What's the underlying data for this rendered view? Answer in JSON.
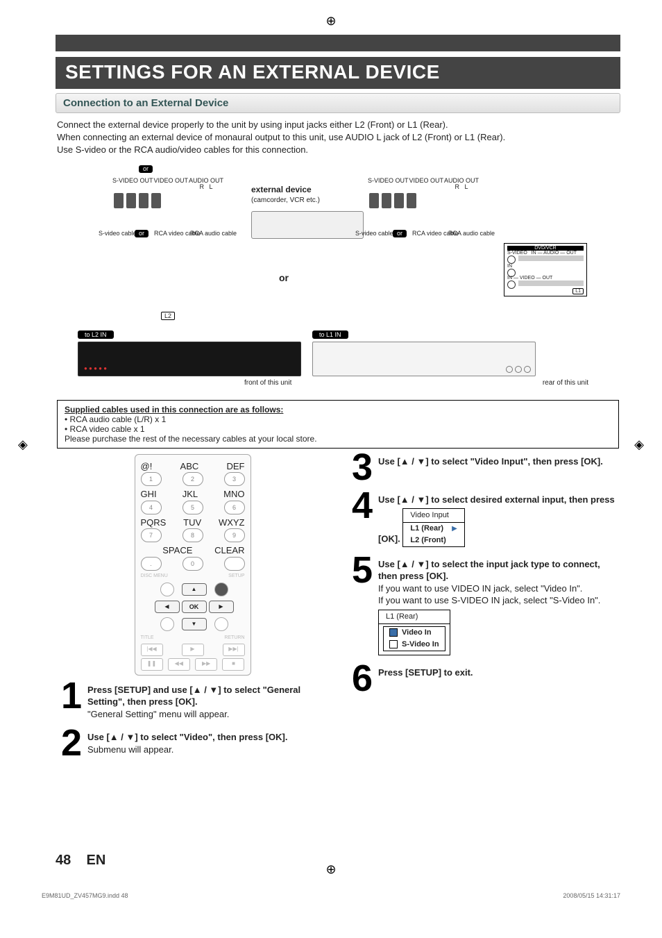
{
  "colors": {
    "band": "#444",
    "accent": "#3a6ea8"
  },
  "title": "SETTINGS FOR AN EXTERNAL DEVICE",
  "subheading": "Connection to an External Device",
  "intro": [
    "Connect the external device properly to the unit by using input jacks either L2 (Front) or L1 (Rear).",
    "When connecting an external device of monaural output to this unit, use AUDIO L jack of L2 (Front) or L1 (Rear).",
    "Use S-video or the RCA audio/video cables for this connection."
  ],
  "diagram": {
    "or": "or",
    "ports_left": [
      "S-VIDEO OUT",
      "VIDEO OUT",
      "AUDIO OUT",
      "R",
      "L"
    ],
    "ports_right": [
      "S-VIDEO OUT",
      "VIDEO OUT",
      "AUDIO OUT",
      "R",
      "L"
    ],
    "cable_labels": [
      "S-video cable",
      "RCA video cable",
      "RCA audio cable"
    ],
    "external_device_title": "external device",
    "external_device_sub": "(camcorder, VCR etc.)",
    "big_or": "or",
    "to_l2": "to L2 IN",
    "to_l1": "to L1 IN",
    "L2": "L2",
    "L1": "L1",
    "dvd_vcr": "DVD/VCR",
    "svideo": "S-VIDEO",
    "in_video_out": "IN — VIDEO — OUT",
    "in_audio_out": "IN — AUDIO — OUT",
    "in": "IN",
    "front_caption": "front of this unit",
    "rear_caption": "rear of this unit"
  },
  "cables_note": {
    "heading": "Supplied cables used in this connection are as follows:",
    "items": [
      "• RCA audio cable (L/R) x 1",
      "• RCA video cable x 1"
    ],
    "footer": "Please purchase the rest of the necessary cables at your local store."
  },
  "remote": {
    "numTop": [
      [
        "@!",
        "ABC",
        "DEF"
      ],
      [
        "1",
        "2",
        "3"
      ],
      [
        "GHI",
        "JKL",
        "MNO"
      ],
      [
        "4",
        "5",
        "6"
      ],
      [
        "PQRS",
        "TUV",
        "WXYZ"
      ],
      [
        "7",
        "8",
        "9"
      ],
      [
        "",
        "SPACE",
        "CLEAR"
      ],
      [
        ".",
        "0",
        ""
      ]
    ],
    "disc_menu": "DISC MENU",
    "setup": "SETUP",
    "ok": "OK",
    "title": "TITLE",
    "return": "RETURN"
  },
  "steps": {
    "1": {
      "num": "1",
      "main": "Press [SETUP] and use [▲ / ▼] to select \"General Setting\", then press [OK].",
      "sub": "\"General Setting\" menu will appear."
    },
    "2": {
      "num": "2",
      "main": "Use [▲ / ▼] to select \"Video\", then press [OK].",
      "sub": "Submenu will appear."
    },
    "3": {
      "num": "3",
      "main": "Use [▲ / ▼] to select \"Video Input\", then press [OK]."
    },
    "4": {
      "num": "4",
      "main": "Use [▲ / ▼] to select desired external input, then press [OK]."
    },
    "5": {
      "num": "5",
      "main": "Use [▲ / ▼] to select the input jack type to connect, then press [OK].",
      "sub1": "If you want to use VIDEO IN jack, select \"Video In\".",
      "sub2": " If you want to use S-VIDEO IN jack, select \"S-Video In\"."
    },
    "6": {
      "num": "6",
      "main": "Press [SETUP] to exit."
    }
  },
  "menu4": {
    "header": "Video Input",
    "row1": "L1 (Rear)",
    "row2": "L2 (Front)"
  },
  "menu5": {
    "header": "L1 (Rear)",
    "row1": "Video In",
    "row2": "S-Video In"
  },
  "footer": {
    "page": "48",
    "lang": "EN"
  },
  "print": {
    "left": "E9M81UD_ZV457MG9.indd   48",
    "right": "2008/05/15   14:31:17"
  }
}
